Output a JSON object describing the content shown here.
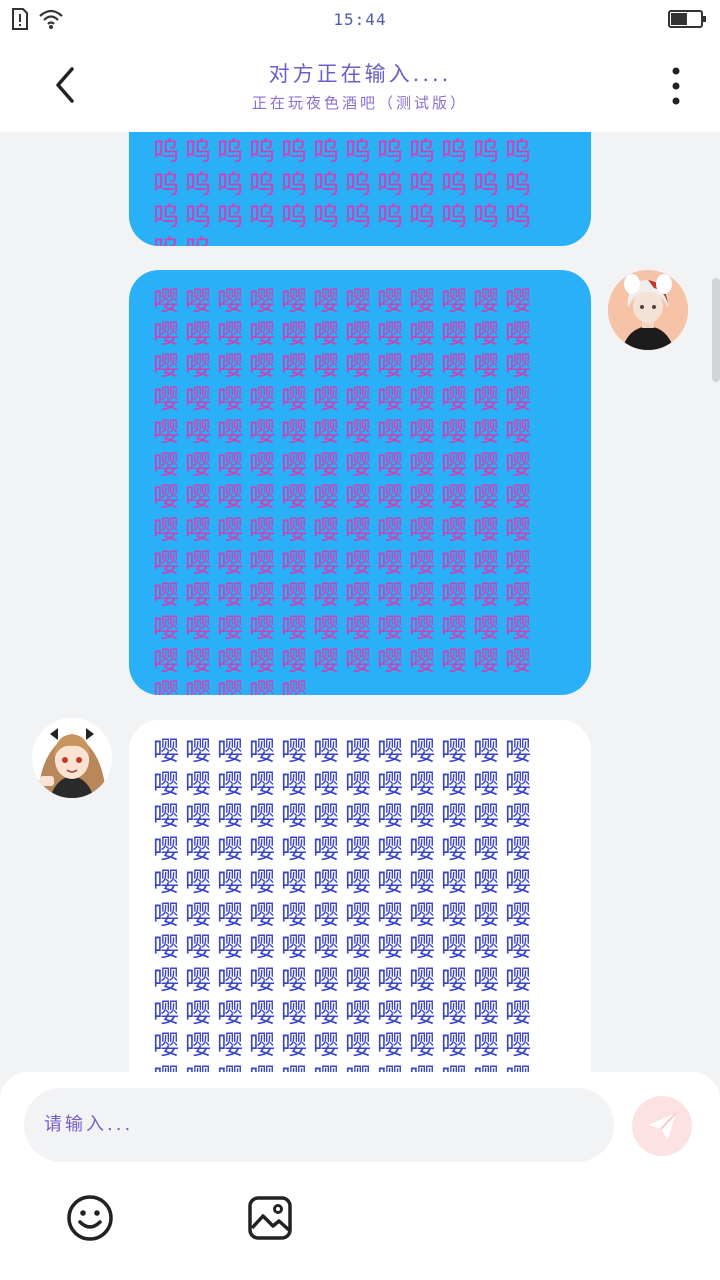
{
  "status_bar": {
    "time": "15:44",
    "icons": [
      "sim-alert-icon",
      "wifi-icon",
      "battery-icon"
    ],
    "battery_level": 0.55
  },
  "header": {
    "title": "对方正在输入....",
    "subtitle": "正在玩夜色酒吧（测试版）",
    "back_icon": "chevron-left-icon",
    "more_icon": "more-vertical-icon"
  },
  "messages": [
    {
      "side": "other",
      "style": "blue",
      "text": "呜呜呜呜呜呜呜呜呜呜呜呜呜呜呜呜呜呜呜呜呜呜呜呜呜呜呜呜呜呜呜呜呜呜呜呜呜呜"
    },
    {
      "side": "me",
      "style": "blue",
      "avatar": "avatar-white-hair-boy",
      "text": "嘤嘤嘤嘤嘤嘤嘤嘤嘤嘤嘤嘤嘤嘤嘤嘤嘤嘤嘤嘤嘤嘤嘤嘤嘤嘤嘤嘤嘤嘤嘤嘤嘤嘤嘤嘤嘤嘤嘤嘤嘤嘤嘤嘤嘤嘤嘤嘤嘤嘤嘤嘤嘤嘤嘤嘤嘤嘤嘤嘤嘤嘤嘤嘤嘤嘤嘤嘤嘤嘤嘤嘤嘤嘤嘤嘤嘤嘤嘤嘤嘤嘤嘤嘤嘤嘤嘤嘤嘤嘤嘤嘤嘤嘤嘤嘤嘤嘤嘤嘤嘤嘤嘤嘤嘤嘤嘤嘤嘤嘤嘤嘤嘤嘤嘤嘤嘤嘤嘤嘤嘤嘤嘤嘤嘤嘤嘤嘤嘤嘤嘤嘤嘤嘤嘤嘤嘤嘤嘤嘤嘤嘤嘤嘤嘤嘤嘤嘤嘤"
    },
    {
      "side": "other",
      "style": "white",
      "avatar": "avatar-twin-tail-girl",
      "text": "嘤嘤嘤嘤嘤嘤嘤嘤嘤嘤嘤嘤嘤嘤嘤嘤嘤嘤嘤嘤嘤嘤嘤嘤嘤嘤嘤嘤嘤嘤嘤嘤嘤嘤嘤嘤嘤嘤嘤嘤嘤嘤嘤嘤嘤嘤嘤嘤嘤嘤嘤嘤嘤嘤嘤嘤嘤嘤嘤嘤嘤嘤嘤嘤嘤嘤嘤嘤嘤嘤嘤嘤嘤嘤嘤嘤嘤嘤嘤嘤嘤嘤嘤嘤嘤嘤嘤嘤嘤嘤嘤嘤嘤嘤嘤嘤嘤嘤嘤嘤嘤嘤嘤嘤嘤嘤嘤嘤嘤嘤嘤嘤嘤嘤嘤嘤嘤嘤嘤嘤嘤嘤嘤嘤嘤嘤嘤嘤嘤嘤嘤嘤嘤嘤嘤嘤嘤嘤嘤嘤嘤嘤嘤嘤嘤嘤嘤嘤"
    }
  ],
  "composer": {
    "placeholder": "请输入...",
    "send_icon": "paper-plane-icon",
    "emoji_icon": "smiley-icon",
    "image_icon": "image-icon"
  }
}
